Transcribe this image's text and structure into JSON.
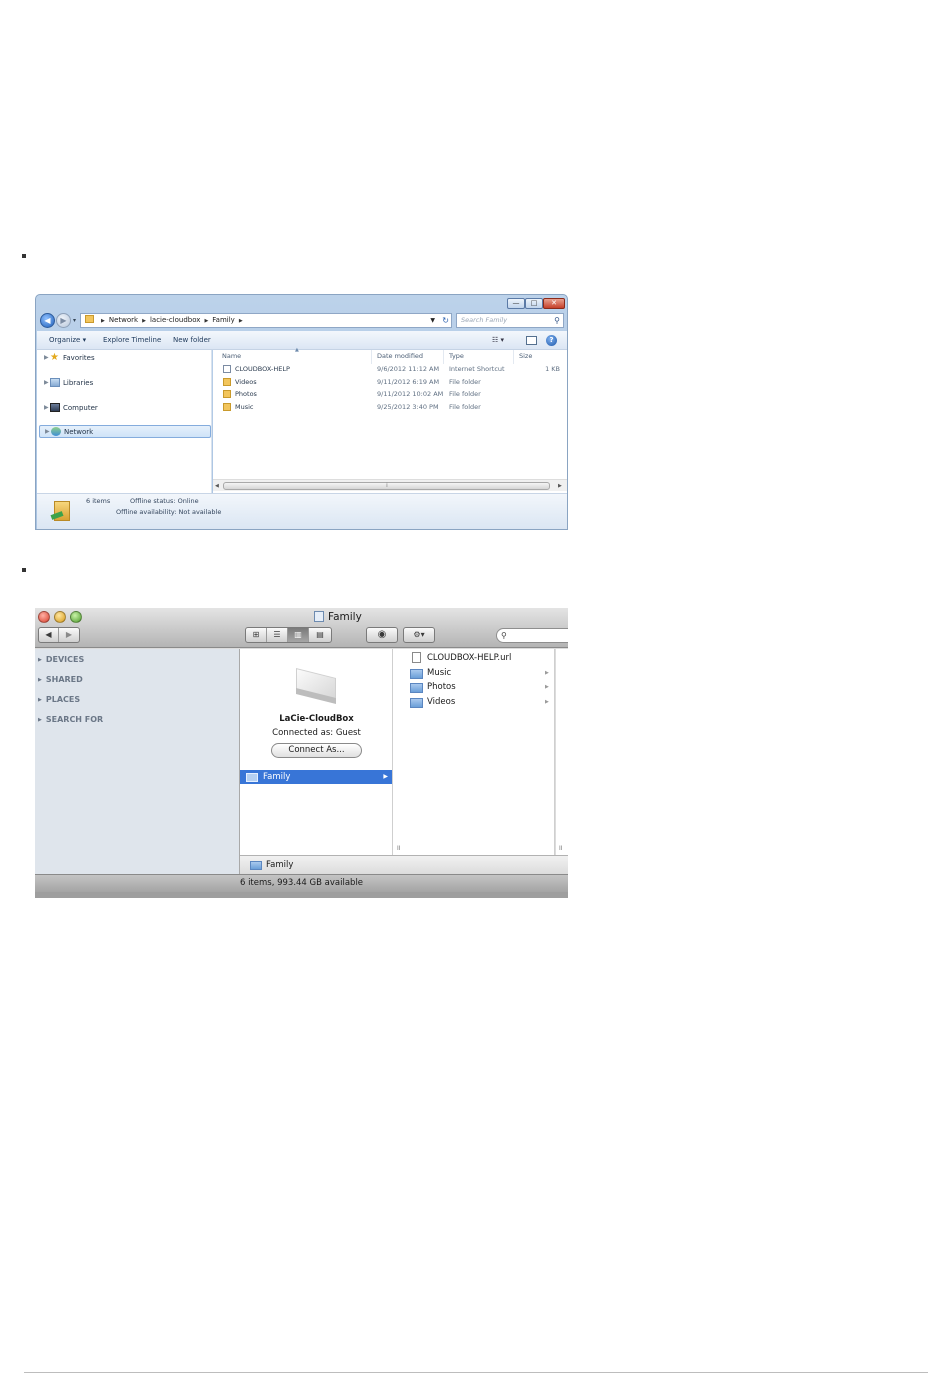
{
  "windows_explorer": {
    "breadcrumb": [
      "Network",
      "lacie-cloudbox",
      "Family"
    ],
    "search_placeholder": "Search Family",
    "toolbar": {
      "organize": "Organize ▾",
      "explore_timeline": "Explore Timeline",
      "new_folder": "New folder"
    },
    "nav_pane": [
      {
        "label": "Favorites",
        "icon": "star-icon"
      },
      {
        "label": "Libraries",
        "icon": "libraries-icon"
      },
      {
        "label": "Computer",
        "icon": "computer-icon"
      },
      {
        "label": "Network",
        "icon": "network-icon",
        "selected": true
      }
    ],
    "columns": {
      "name": "Name",
      "date": "Date modified",
      "type": "Type",
      "size": "Size"
    },
    "files": [
      {
        "name": "CLOUDBOX-HELP",
        "date": "9/6/2012 11:12 AM",
        "type": "Internet Shortcut",
        "size": "1 KB",
        "icon": "shortcut"
      },
      {
        "name": "Videos",
        "date": "9/11/2012 6:19 AM",
        "type": "File folder",
        "size": "",
        "icon": "folder"
      },
      {
        "name": "Photos",
        "date": "9/11/2012 10:02 AM",
        "type": "File folder",
        "size": "",
        "icon": "folder"
      },
      {
        "name": "Music",
        "date": "9/25/2012 3:40 PM",
        "type": "File folder",
        "size": "",
        "icon": "folder"
      }
    ],
    "details": {
      "count": "6 items",
      "offline_status": "Offline status: Online",
      "offline_availability": "Offline availability: Not available"
    }
  },
  "mac_finder": {
    "title": "Family",
    "sidebar": [
      "DEVICES",
      "SHARED",
      "PLACES",
      "SEARCH FOR"
    ],
    "server": {
      "name": "LaCie-CloudBox",
      "status": "Connected as: Guest",
      "connect_label": "Connect As..."
    },
    "column1_selected": "Family",
    "column2": [
      {
        "name": "CLOUDBOX-HELP.url",
        "icon": "doc"
      },
      {
        "name": "Music",
        "icon": "folder"
      },
      {
        "name": "Photos",
        "icon": "folder"
      },
      {
        "name": "Videos",
        "icon": "folder"
      }
    ],
    "path_bar": "Family",
    "status_bar": "6 items, 993.44 GB available"
  }
}
